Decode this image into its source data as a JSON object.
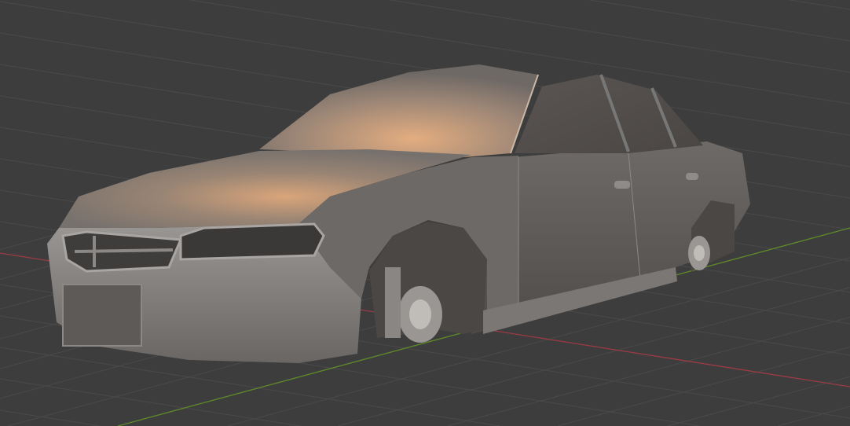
{
  "viewport": {
    "background_color": "#3d3d3d",
    "grid_color": "#4a4a4a",
    "x_axis_color": "#9c3b45",
    "y_axis_color": "#5f8a2a",
    "model_color": "#8a8683",
    "highlight_color": "#e0a878"
  }
}
